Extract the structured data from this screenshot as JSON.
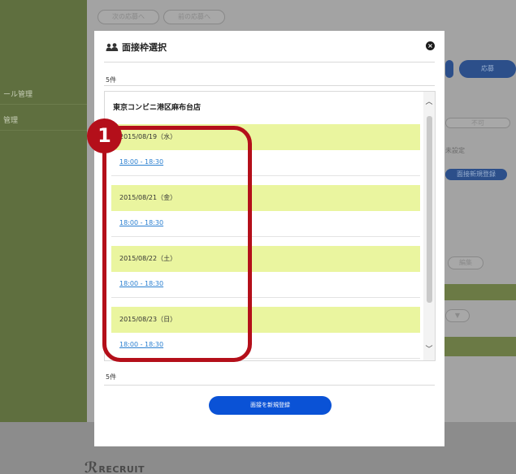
{
  "background": {
    "sidebar_items": [
      "ール管理",
      "管理"
    ],
    "pills": [
      "次の応募へ",
      "前の応募へ"
    ],
    "right_texts": [
      "応募",
      "不可",
      "未設定",
      "面接新規登録",
      "編集"
    ],
    "footer_logo": "RECRUIT"
  },
  "modal": {
    "title": "面接枠選択",
    "title_icon": "people-icon",
    "count_top": "5件",
    "count_bottom": "5件",
    "store_name": "東京コンビニ港区麻布台店",
    "dates": [
      {
        "date": "2015/08/19（水）",
        "slot": "18:00 - 18:30"
      },
      {
        "date": "2015/08/21（金）",
        "slot": "18:00 - 18:30"
      },
      {
        "date": "2015/08/22（土）",
        "slot": "18:00 - 18:30"
      },
      {
        "date": "2015/08/23（日）",
        "slot": "18:00 - 18:30"
      }
    ],
    "register_button": "面接を新規登録",
    "close_glyph": "×"
  },
  "annotation": {
    "number": "1",
    "color": "#b40f1a"
  },
  "colors": {
    "date_band": "#eaf59f",
    "link": "#2a7fd0",
    "primary_button": "#0a52d6"
  }
}
